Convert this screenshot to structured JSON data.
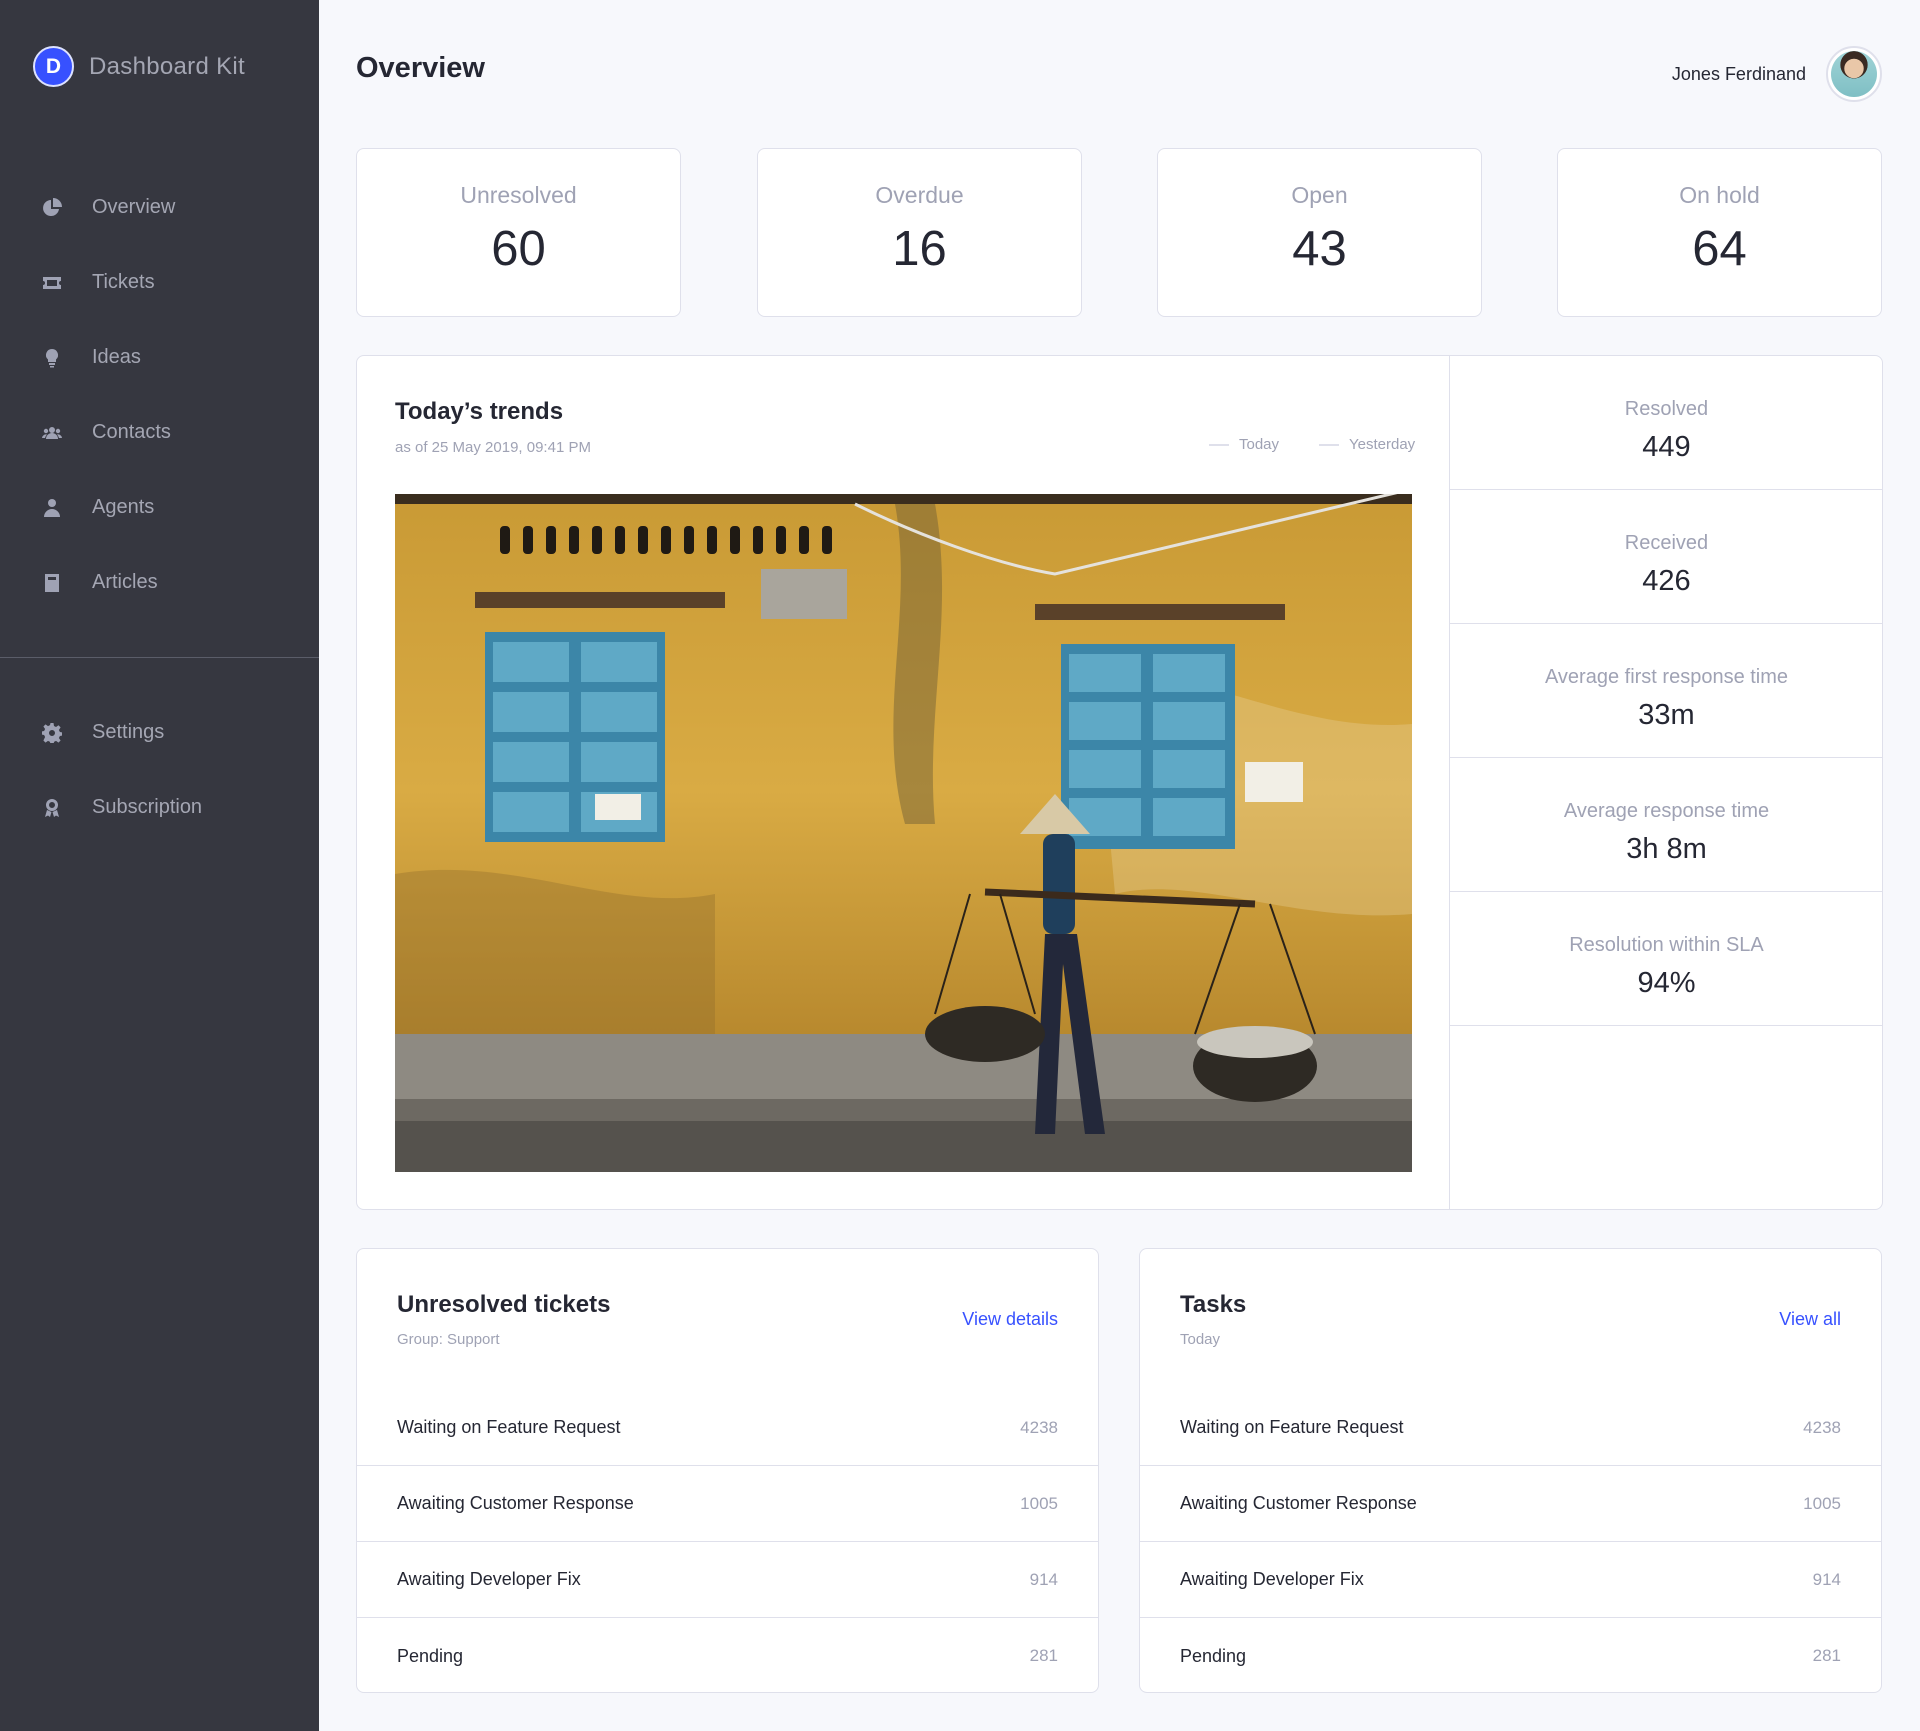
{
  "brand": {
    "logo_letter": "D",
    "name": "Dashboard Kit"
  },
  "sidebar": {
    "items": [
      {
        "label": "Overview",
        "icon": "pie-chart-icon"
      },
      {
        "label": "Tickets",
        "icon": "ticket-icon"
      },
      {
        "label": "Ideas",
        "icon": "lightbulb-icon"
      },
      {
        "label": "Contacts",
        "icon": "users-icon"
      },
      {
        "label": "Agents",
        "icon": "user-tie-icon"
      },
      {
        "label": "Articles",
        "icon": "book-icon"
      }
    ],
    "bottom_items": [
      {
        "label": "Settings",
        "icon": "gear-icon"
      },
      {
        "label": "Subscription",
        "icon": "award-icon"
      }
    ]
  },
  "header": {
    "title": "Overview",
    "user_name": "Jones Ferdinand"
  },
  "stats": [
    {
      "label": "Unresolved",
      "value": "60"
    },
    {
      "label": "Overdue",
      "value": "16"
    },
    {
      "label": "Open",
      "value": "43"
    },
    {
      "label": "On hold",
      "value": "64"
    }
  ],
  "trends": {
    "title": "Today’s trends",
    "subtitle": "as of 25 May 2019, 09:41 PM",
    "legend": [
      {
        "label": "Today",
        "color": "#dfe0eb"
      },
      {
        "label": "Yesterday",
        "color": "#dfe0eb"
      }
    ]
  },
  "side_stats": [
    {
      "label": "Resolved",
      "value": "449"
    },
    {
      "label": "Received",
      "value": "426"
    },
    {
      "label": "Average first response time",
      "value": "33m"
    },
    {
      "label": "Average response time",
      "value": "3h 8m"
    },
    {
      "label": "Resolution within SLA",
      "value": "94%"
    }
  ],
  "unresolved": {
    "title": "Unresolved tickets",
    "subtitle": "Group: Support",
    "link": "View details",
    "rows": [
      {
        "label": "Waiting on Feature Request",
        "value": "4238"
      },
      {
        "label": "Awaiting Customer Response",
        "value": "1005"
      },
      {
        "label": "Awaiting Developer Fix",
        "value": "914"
      },
      {
        "label": "Pending",
        "value": "281"
      }
    ]
  },
  "tasks": {
    "title": "Tasks",
    "subtitle": "Today",
    "link": "View all",
    "rows": [
      {
        "label": "Waiting on Feature Request",
        "value": "4238"
      },
      {
        "label": "Awaiting Customer Response",
        "value": "1005"
      },
      {
        "label": "Awaiting Developer Fix",
        "value": "914"
      },
      {
        "label": "Pending",
        "value": "281"
      }
    ]
  },
  "colors": {
    "accent": "#3751ff",
    "sidebar_bg": "#363740",
    "muted": "#9fa2b4",
    "border": "#dfe0eb"
  }
}
